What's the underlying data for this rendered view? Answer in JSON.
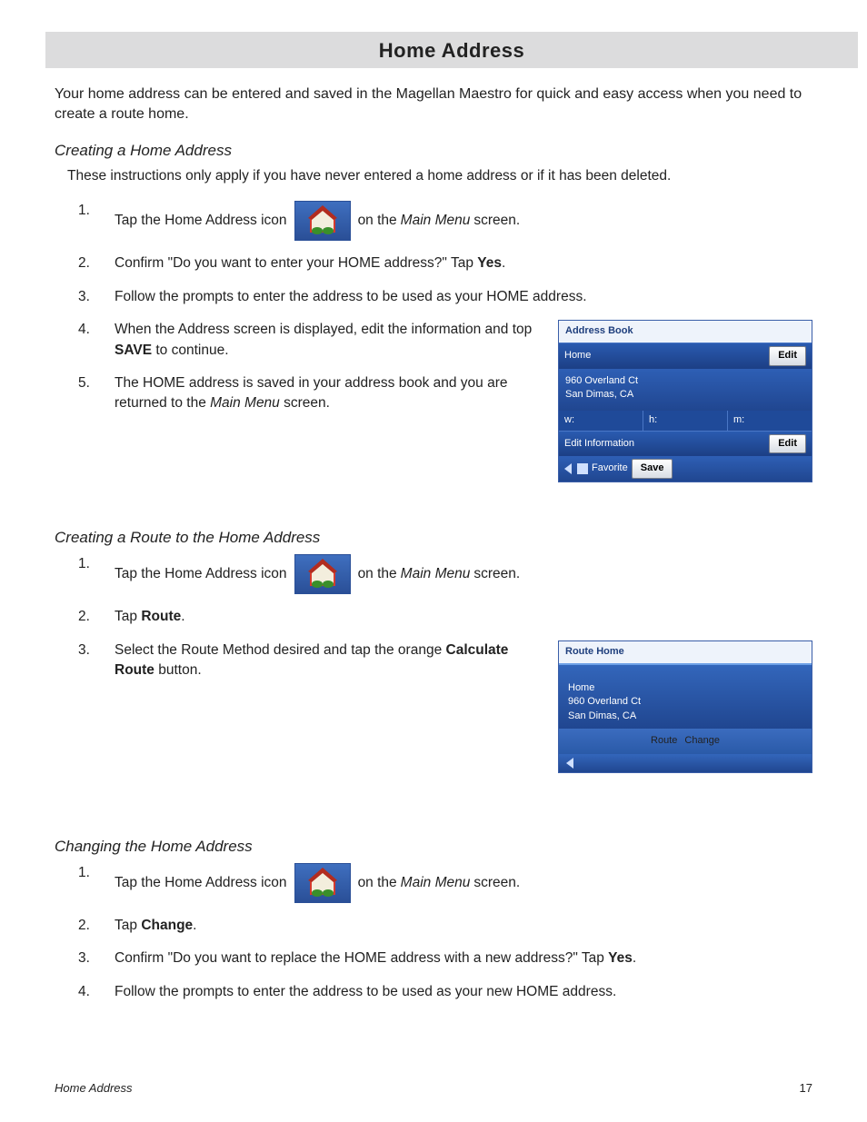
{
  "title": "Home Address",
  "intro": "Your home address can be entered and saved in the Magellan Maestro for quick and easy access when you need to create a route home.",
  "section1": {
    "heading": "Creating a Home Address",
    "note": "These instructions only apply if you have never entered a home address or if it has been deleted.",
    "step1_a": "Tap the Home Address icon ",
    "step1_b": " on the ",
    "step1_menu": "Main Menu",
    "step1_c": " screen.",
    "step2_a": "Confirm \"Do you want to enter your HOME address?\"  Tap ",
    "step2_b": "Yes",
    "step2_c": ".",
    "step3": "Follow the prompts to enter the address to be used as your HOME address.",
    "step4_a": "When the Address screen is displayed, edit the information and top ",
    "step4_b": "SAVE",
    "step4_c": " to continue.",
    "step5_a": "The HOME address is saved in your address book and you are returned to the ",
    "step5_menu": "Main Menu",
    "step5_b": " screen."
  },
  "shot1": {
    "title": "Address Book",
    "row_home": "Home",
    "edit": "Edit",
    "addr1": "960 Overland Ct",
    "addr2": "San Dimas, CA",
    "w": "w:",
    "h": "h:",
    "m": "m:",
    "editinfo": "Edit Information",
    "fav": "Favorite",
    "save": "Save"
  },
  "section2": {
    "heading": "Creating a Route to the Home Address",
    "step1_a": "Tap the Home Address icon ",
    "step1_b": " on the ",
    "step1_menu": "Main Menu",
    "step1_c": " screen.",
    "step2_a": "Tap ",
    "step2_b": "Route",
    "step2_c": ".",
    "step3_a": "Select the Route Method desired and tap the orange ",
    "step3_b": "Calculate Route",
    "step3_c": " button."
  },
  "shot2": {
    "title": "Route Home",
    "line1": "Home",
    "line2": "960 Overland Ct",
    "line3": "San Dimas, CA",
    "route": "Route",
    "change": "Change"
  },
  "section3": {
    "heading": "Changing the Home Address",
    "step1_a": "Tap the Home Address icon ",
    "step1_b": " on the ",
    "step1_menu": "Main Menu",
    "step1_c": " screen.",
    "step2_a": "Tap ",
    "step2_b": "Change",
    "step2_c": ".",
    "step3_a": "Confirm \"Do you want to replace the HOME address with a new address?\"  Tap ",
    "step3_b": "Yes",
    "step3_c": ".",
    "step4": "Follow the prompts to enter the address to be used as your new HOME address."
  },
  "footer": {
    "left": "Home Address",
    "right": "17"
  }
}
